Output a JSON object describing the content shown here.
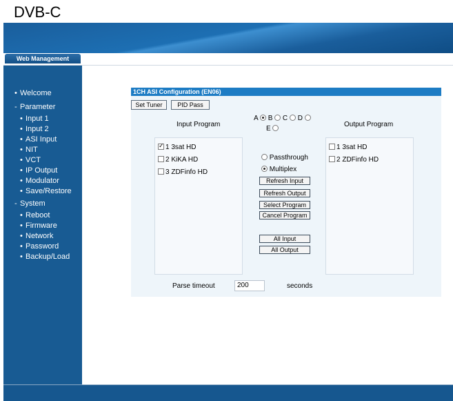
{
  "caption": "DVB-C",
  "header": {
    "tab_label": "Web Management"
  },
  "sidebar": {
    "welcome": "Welcome",
    "parameter": "Parameter",
    "parameter_items": [
      "Input 1",
      "Input 2",
      "ASI Input",
      "NIT",
      "VCT",
      "IP Output",
      "Modulator",
      "Save/Restore"
    ],
    "system": "System",
    "system_items": [
      "Reboot",
      "Firmware",
      "Network",
      "Password",
      "Backup/Load"
    ]
  },
  "config": {
    "title": "1CH ASI Configuration (EN06)",
    "set_tuner": "Set Tuner",
    "pid_pass": "PID Pass",
    "input_program_header": "Input Program",
    "output_program_header": "Output Program",
    "radio_options": {
      "a": "A",
      "b": "B",
      "c": "C",
      "d": "D",
      "e": "E"
    },
    "selected_port": "A",
    "input_programs": [
      {
        "label": "1 3sat HD",
        "checked": true
      },
      {
        "label": "2 KiKA HD",
        "checked": false
      },
      {
        "label": "3 ZDFinfo HD",
        "checked": false
      }
    ],
    "output_programs": [
      {
        "label": "1 3sat HD",
        "checked": false
      },
      {
        "label": "2 ZDFinfo HD",
        "checked": false
      }
    ],
    "mode_passthrough": "Passthrough",
    "mode_multiplex": "Multiplex",
    "selected_mode": "Multiplex",
    "buttons": {
      "refresh_input": "Refresh Input",
      "refresh_output": "Refresh Output",
      "select_program": "Select Program",
      "cancel_program": "Cancel Program",
      "all_input": "All Input",
      "all_output": "All Output"
    },
    "parse_timeout_label": "Parse timeout",
    "parse_timeout_value": "200",
    "seconds_label": "seconds"
  },
  "colors": {
    "banner": "#1d6fb3",
    "sidebar": "#185b93",
    "title_bar": "#1d7cc4",
    "content_bg": "#eef5fa"
  },
  "icons": {
    "checkbox": "checkbox-icon",
    "radio": "radio-icon"
  }
}
